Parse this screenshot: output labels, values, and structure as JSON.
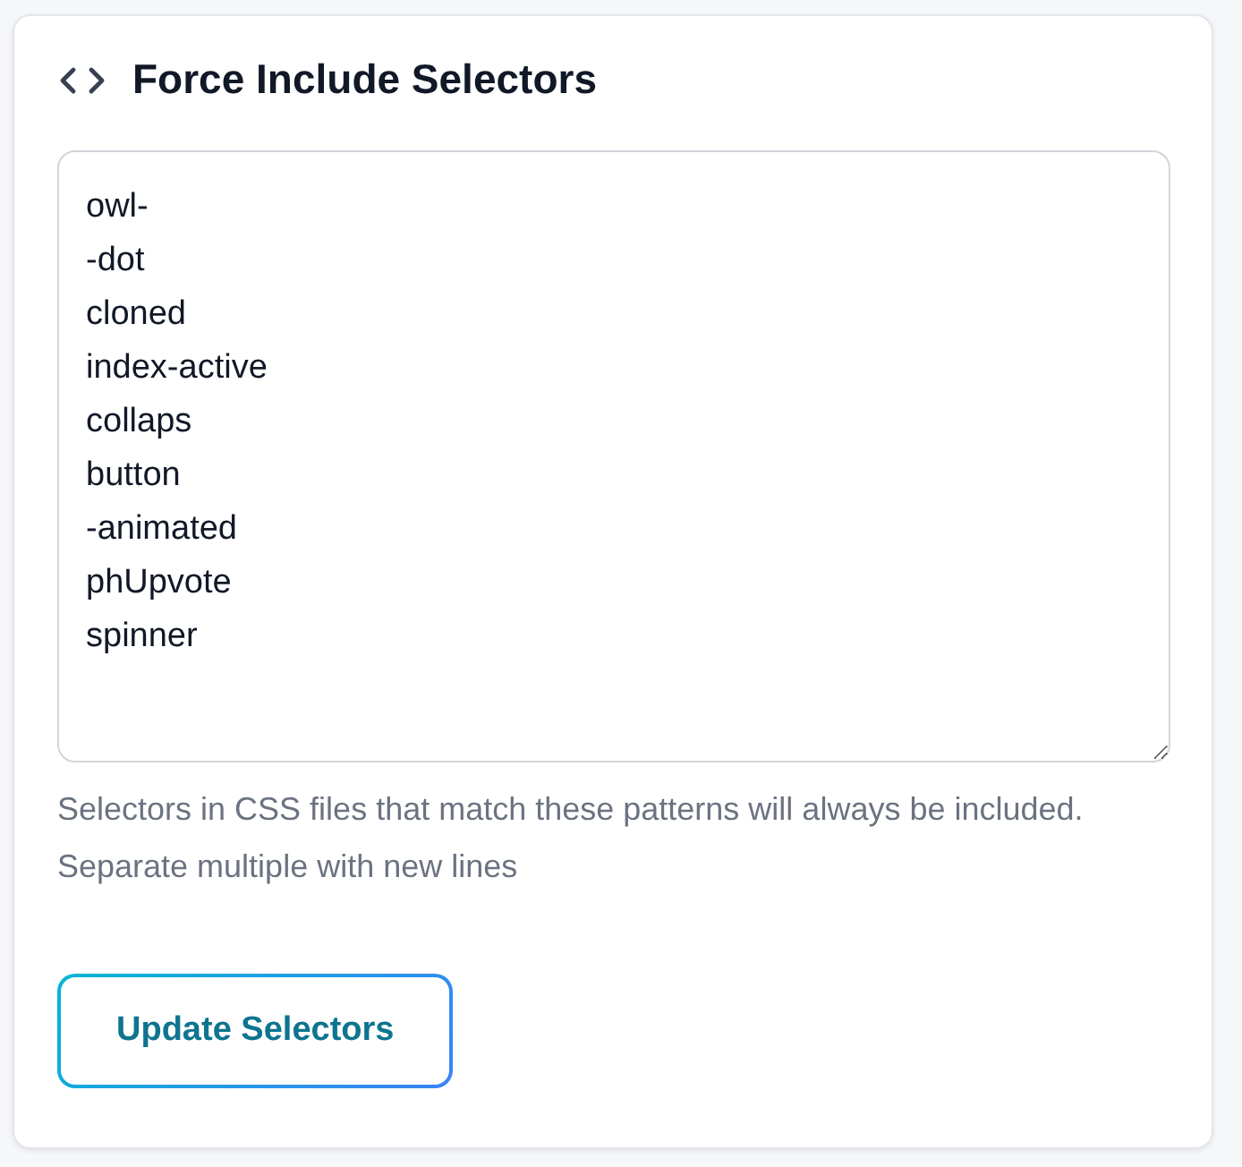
{
  "card": {
    "title": "Force Include Selectors",
    "selectors_field": {
      "value": "owl-\n-dot\ncloned\nindex-active\ncollaps\nbutton\n-animated\nphUpvote\nspinner"
    },
    "help_text": "Selectors in CSS files that match these patterns will always be included. Separate multiple with new lines",
    "button": "Update Selectors"
  }
}
